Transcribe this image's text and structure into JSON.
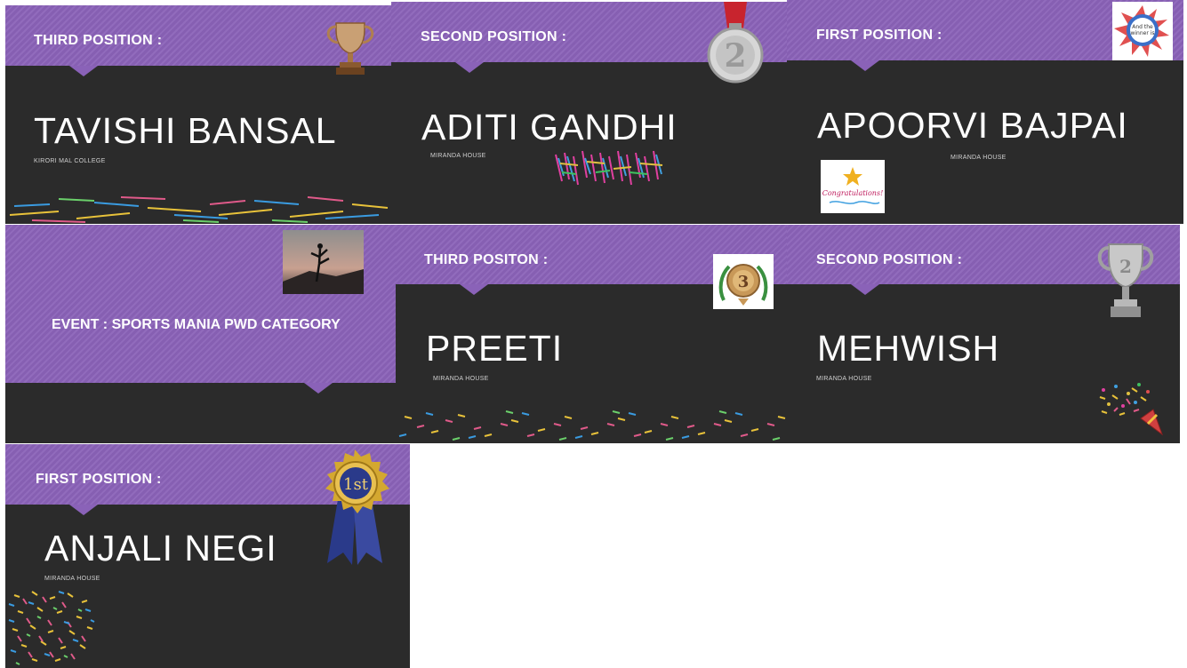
{
  "slides": [
    {
      "heading": "THIRD POSITION :",
      "name": "TAVISHI BANSAL",
      "college": "KIRORI MAL COLLEGE",
      "icon": "bronze-trophy-icon"
    },
    {
      "heading": "SECOND POSITION :",
      "name": "ADITI GANDHI",
      "college": "MIRANDA HOUSE",
      "icon": "silver-medal-icon"
    },
    {
      "heading": "FIRST POSITION :",
      "name": "APOORVI BAJPAI",
      "college": "MIRANDA HOUSE",
      "icon": "winner-badge-icon",
      "badge_text": "And the winner is",
      "sticker_text": "Congratulations!"
    },
    {
      "heading": "EVENT : SPORTS MANIA PWD CATEGORY",
      "icon": "yoga-silhouette-photo"
    },
    {
      "heading": "THIRD POSITON :",
      "name": "PREETI",
      "college": "MIRANDA HOUSE",
      "icon": "third-place-medal-icon",
      "medal_text": "3"
    },
    {
      "heading": "SECOND POSITION :",
      "name": "MEHWISH",
      "college": "MIRANDA HOUSE",
      "icon": "silver-cup-icon",
      "cup_text": "2"
    },
    {
      "heading": "FIRST POSITION :",
      "name": "ANJALI NEGI",
      "college": "MIRANDA HOUSE",
      "icon": "first-place-ribbon-icon",
      "ribbon_text": "1st"
    }
  ],
  "colors": {
    "band": "#8a62b8",
    "slide_bg": "#2b2b2b",
    "text": "#ffffff",
    "page_bg": "#ffffff"
  }
}
